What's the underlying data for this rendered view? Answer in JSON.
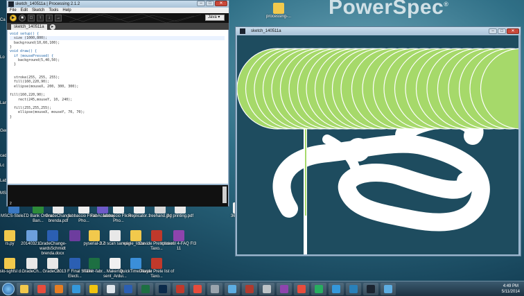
{
  "desktop": {
    "brand": "PowerSpec",
    "top_icon": "processing-...",
    "left_tags": [
      "Ca",
      "Lo",
      "Lamb",
      "Geni",
      "cad",
      "Lc",
      "Lab",
      "MSCS"
    ],
    "row1": [
      {
        "label": "MSCS-Stele...",
        "color": "#3a78c2"
      },
      {
        "label": "TD Bank Online Ban...",
        "color": "#2e8b3a"
      },
      {
        "label": "GradeChange brenda.pdf",
        "color": "#e9e9e9"
      },
      {
        "label": "fabbaccio Flickr - Pho...",
        "color": "#f0f0f0"
      },
      {
        "label": "FabAcademy",
        "color": "#6e5ac8"
      },
      {
        "label": "fabbaccio Flickr - Pho...",
        "color": "#f0f0f0"
      },
      {
        "label": "Replicator...",
        "color": "#f0f0f0"
      },
      {
        "label": "freehand.jpg",
        "color": "#d9d9d9"
      },
      {
        "label": "3d printing.pdf",
        "color": "#e9e9e9"
      },
      {
        "label": "360 Pi...",
        "color": "#f0f0f0"
      }
    ],
    "row2": [
      {
        "label": "rs.py",
        "color": "#f2c94c"
      },
      {
        "label": "20140321...",
        "color": "#6ca0dc"
      },
      {
        "label": "GradeChange-wardsSchmidt brenda.docx",
        "color": "#2b5fb3"
      },
      {
        "label": "",
        "color": "#6d3d9e"
      },
      {
        "label": "pyserial-2.7",
        "color": "#f2c94c"
      },
      {
        "label": "3.d scan sample",
        "color": "#e8e8e8"
      },
      {
        "label": "eagle_librar...",
        "color": "#f2c94c"
      },
      {
        "label": "Davide Prete list of Taxo...",
        "color": "#c0392b"
      },
      {
        "label": "tpsserol 4-FAQ FI3 11",
        "color": "#8e44ad"
      }
    ],
    "row3": [
      {
        "label": "haslo-sghfsl d...",
        "color": "#f2c94c"
      },
      {
        "label": "GradeCh...",
        "color": "#e8e8e8"
      },
      {
        "label": "GradeCh...",
        "color": "#e8e8e8"
      },
      {
        "label": "2013 F Final STEM Electi...",
        "color": "#2b5fb3"
      },
      {
        "label": "maker-fabr...",
        "color": "#1d6f42"
      },
      {
        "label": "MakerUp sent_Ardui...",
        "color": "#f0f0f0"
      },
      {
        "label": "QuickTime Player",
        "color": "#3b8fd9"
      },
      {
        "label": "Davide Prete list of Taxo...",
        "color": "#c0392b"
      }
    ]
  },
  "processing_window": {
    "title": "sketch_140511a | Processing 2.1.2",
    "menu": [
      "File",
      "Edit",
      "Sketch",
      "Tools",
      "Help"
    ],
    "toolbar": [
      "▶",
      "■",
      "□",
      "↑",
      "↓",
      "→"
    ],
    "mode": "Java ▾",
    "tab": "sketch_140511a",
    "add_tab": "▸",
    "code_lines": [
      {
        "text": "void setup() {",
        "kw": true
      },
      {
        "text": "  size (1000,800);",
        "kw": false
      },
      {
        "text": "  background(10,60,100);",
        "kw": false
      },
      {
        "text": "}",
        "kw": false
      },
      {
        "text": "void draw() {",
        "kw": true
      },
      {
        "text": "  if (mousePressed) {",
        "kw": true
      },
      {
        "text": "    background(5,40,50);",
        "kw": false
      },
      {
        "text": "  }",
        "kw": false
      },
      {
        "text": "",
        "kw": false
      },
      {
        "text": "",
        "kw": false
      },
      {
        "text": "  stroke(255, 255, 255);",
        "kw": false
      },
      {
        "text": "  fill(160,220,90);",
        "kw": false
      },
      {
        "text": "  ellipse(mouseX, 200, 300, 300);",
        "kw": false
      },
      {
        "text": "",
        "kw": false
      },
      {
        "text": "fill(160,220,90);",
        "kw": false
      },
      {
        "text": "    rect(245,mouseY, 10, 240);",
        "kw": false
      },
      {
        "text": "",
        "kw": false
      },
      {
        "text": "  fill(255,255,255);",
        "kw": false
      },
      {
        "text": "    ellipse(mouseX, mouseY, 70, 70);",
        "kw": false
      },
      {
        "text": "}",
        "kw": false
      }
    ],
    "line_number": "2"
  },
  "sketch_window": {
    "title": "sketch_140511a",
    "background": "#1e4c5f",
    "circle_color": "#a6d96a"
  },
  "taskbar": {
    "apps": [
      {
        "name": "explorer",
        "color": "#f2c94c"
      },
      {
        "name": "chrome",
        "color": "#e74c3c"
      },
      {
        "name": "firefox",
        "color": "#e67e22"
      },
      {
        "name": "windows-media",
        "color": "#3498db"
      },
      {
        "name": "stickies",
        "color": "#f1c40f"
      },
      {
        "name": "notepad",
        "color": "#dfe6ec"
      },
      {
        "name": "word",
        "color": "#2b5fb3"
      },
      {
        "name": "excel",
        "color": "#1d6f42"
      },
      {
        "name": "photoshop",
        "color": "#0b2a4a"
      },
      {
        "name": "illustrator",
        "color": "#c0392b"
      },
      {
        "name": "acrobat",
        "color": "#e74c3c"
      },
      {
        "name": "camera",
        "color": "#9aa4ad"
      },
      {
        "name": "mail",
        "color": "#5dade2"
      },
      {
        "name": "filemaker",
        "color": "#b03a2e"
      },
      {
        "name": "keyboard",
        "color": "#bdc3c7"
      },
      {
        "name": "hp",
        "color": "#8e44ad"
      },
      {
        "name": "chrome-2",
        "color": "#e74c3c"
      },
      {
        "name": "dreamweaver",
        "color": "#27ae60"
      },
      {
        "name": "ie",
        "color": "#3498db"
      },
      {
        "name": "arrows",
        "color": "#2980b9"
      },
      {
        "name": "processing",
        "color": "#1b2430"
      },
      {
        "name": "media-player",
        "color": "#5dade2"
      }
    ],
    "time": "4:49 PM",
    "date": "5/11/2014"
  }
}
